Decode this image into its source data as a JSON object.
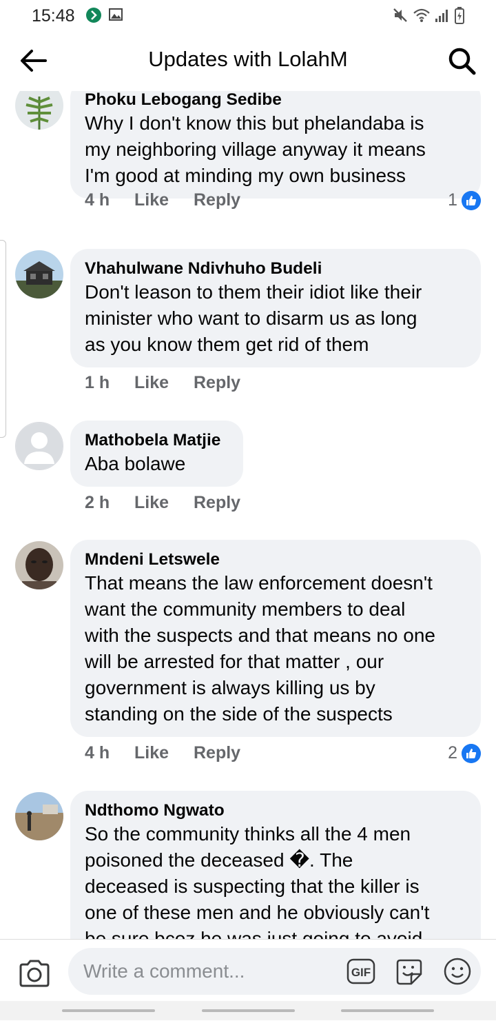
{
  "status_bar": {
    "time": "15:48",
    "left_icons": [
      "app-notification-icon",
      "gallery-icon"
    ],
    "right_icons": [
      "mute-icon",
      "wifi-icon",
      "signal-icon",
      "battery-charging-icon"
    ]
  },
  "header": {
    "title": "Updates with LolahM",
    "back_icon": "arrow-left-icon",
    "search_icon": "search-icon"
  },
  "colors": {
    "bubble": "#f0f2f5",
    "meta_text": "#65676b",
    "like_blue": "#1877f2"
  },
  "comments": [
    {
      "author": "Phoku Lebogang Sedibe",
      "lines": [
        "Why I don't know this but phelandaba is",
        "my neighboring village anyway it means",
        "I'm good at minding my own business"
      ],
      "time": "4 h",
      "like_label": "Like",
      "reply_label": "Reply",
      "reactions": "1"
    },
    {
      "author": "Vhahulwane Ndivhuho Budeli",
      "lines": [
        "Don't leason to them their idiot like their",
        "minister who want to disarm us as long",
        "as you know them get rid of them"
      ],
      "time": "1 h",
      "like_label": "Like",
      "reply_label": "Reply",
      "reactions": ""
    },
    {
      "author": "Mathobela Matjie",
      "lines": [
        "Aba bolawe"
      ],
      "time": "2 h",
      "like_label": "Like",
      "reply_label": "Reply",
      "reactions": ""
    },
    {
      "author": "Mndeni Letswele",
      "lines": [
        "That means the law enforcement doesn't",
        "want the community members to deal",
        "with the suspects and that means no one",
        "will be arrested for that matter , our",
        "government is always killing us by",
        "standing on the side of the suspects"
      ],
      "time": "4 h",
      "like_label": "Like",
      "reply_label": "Reply",
      "reactions": "2"
    },
    {
      "author": "Ndthomo Ngwato",
      "lines": [
        "So the community thinks all the 4 men",
        "poisoned the deceased �. The",
        "deceased is suspecting that the killer is",
        "one of these men and he obviously can't",
        "be sure bcoz he was just going to avoid"
      ],
      "time": "",
      "like_label": "",
      "reply_label": "",
      "reactions": ""
    }
  ],
  "composer": {
    "placeholder": "Write a comment...",
    "camera_icon": "camera-icon",
    "gif_label": "GIF",
    "sticker_icon": "sticker-icon",
    "emoji_icon": "emoji-icon"
  }
}
